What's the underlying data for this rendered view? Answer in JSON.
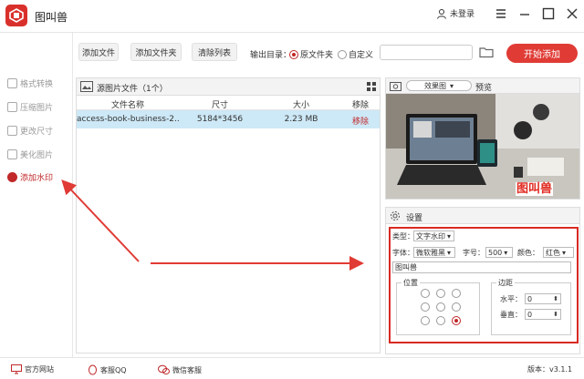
{
  "app": {
    "title": "图叫兽",
    "user": "未登录"
  },
  "sidebar": {
    "items": [
      {
        "label": "格式转换"
      },
      {
        "label": "压缩图片"
      },
      {
        "label": "更改尺寸"
      },
      {
        "label": "美化图片"
      },
      {
        "label": "添加水印",
        "active": true
      }
    ]
  },
  "toolbar": {
    "add_file": "添加文件",
    "add_folder": "添加文件夹",
    "clear_list": "清除列表",
    "output_label": "输出目录：",
    "radio_source": "原文件夹",
    "radio_custom": "自定义",
    "start": "开始添加"
  },
  "files": {
    "title": "源图片文件（1个）",
    "columns": [
      "文件名称",
      "尺寸",
      "大小",
      "移除"
    ],
    "rows": [
      {
        "name": "access-book-business-2...",
        "size": "5184*3456",
        "filesize": "2.23 MB",
        "remove": "移除"
      }
    ]
  },
  "preview": {
    "select": "效果图",
    "label": "预览",
    "watermark": "图叫兽"
  },
  "settings": {
    "title": "设置",
    "type_label": "类型：",
    "type_value": "文字水印",
    "font_label": "字体：",
    "font_value": "微软雅黑",
    "size_label": "字号：",
    "size_value": "500",
    "color_label": "颜色：",
    "color_value": "红色",
    "text_value": "图叫兽",
    "position_label": "位置",
    "margin_label": "边距",
    "horizontal_label": "水平：",
    "horizontal_value": "0",
    "vertical_label": "垂直：",
    "vertical_value": "0"
  },
  "statusbar": {
    "website": "官方网站",
    "qq": "客服QQ",
    "wechat": "微信客服",
    "version": "版本：v3.1.1"
  },
  "colors": {
    "accent": "#c0282a",
    "start": "#e03b35",
    "selected_row": "#cde8f6",
    "highlight_box": "#d82a23"
  }
}
